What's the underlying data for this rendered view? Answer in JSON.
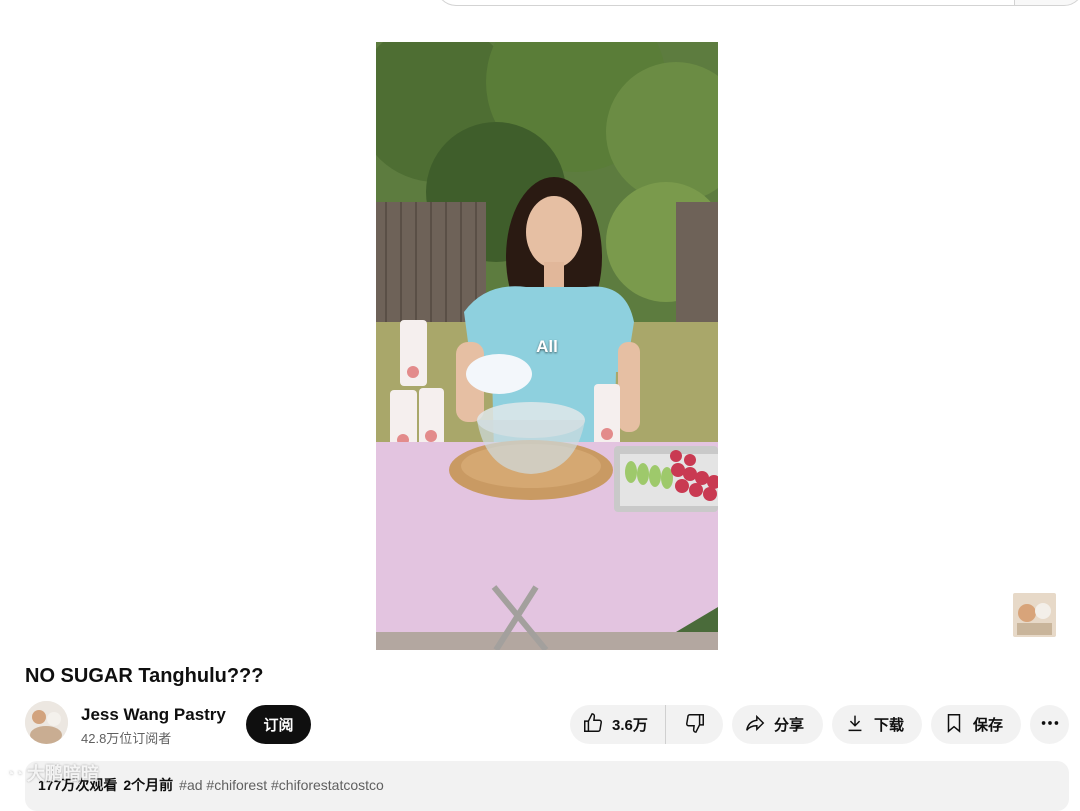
{
  "video": {
    "caption": "All"
  },
  "title": "NO SUGAR Tanghulu???",
  "channel": {
    "name": "Jess Wang Pastry",
    "subscribers": "42.8万位订阅者",
    "subscribe_label": "订阅"
  },
  "actions": {
    "like_count": "3.6万",
    "share_label": "分享",
    "download_label": "下载",
    "save_label": "保存"
  },
  "description": {
    "views": "177万次观看",
    "date": "2个月前",
    "tags": "#ad #chiforest #chiforestatcostco"
  },
  "watermark": {
    "text": "大鹏暗暗"
  },
  "icons": {
    "like": "thumbs-up-icon",
    "dislike": "thumbs-down-icon",
    "share": "share-arrow-icon",
    "download": "download-icon",
    "save": "bookmark-icon",
    "more": "more-horizontal-icon"
  },
  "colors": {
    "subscribe_bg": "#0f0f0f",
    "pill_bg": "#f2f2f2",
    "secondary_text": "#606060"
  }
}
